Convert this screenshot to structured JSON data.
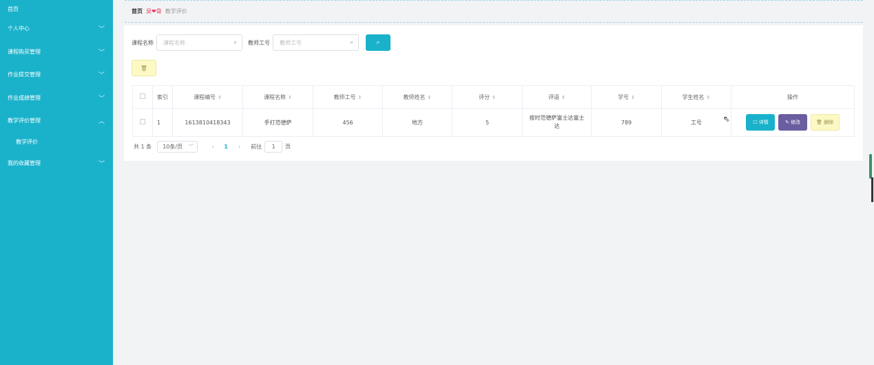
{
  "sidebar": {
    "items": [
      {
        "label": "首页",
        "chevron": ""
      },
      {
        "label": "个人中心",
        "chevron": "﹀"
      },
      {
        "label": "课程购买管理",
        "chevron": "﹀"
      },
      {
        "label": "作业提交管理",
        "chevron": "﹀"
      },
      {
        "label": "作业成绩管理",
        "chevron": "﹀"
      },
      {
        "label": "教学评价管理",
        "chevron": "︿"
      },
      {
        "label": "我的收藏管理",
        "chevron": "﹀"
      }
    ],
    "sub_item": "教学评价"
  },
  "breadcrumb": {
    "home": "首页",
    "separator": "吴❤骨",
    "current": "教学评价"
  },
  "search": {
    "course_name_label": "课程名称",
    "course_name_placeholder": "课程名称",
    "teacher_no_label": "教师工号",
    "teacher_no_placeholder": "教师工号",
    "search_icon": "search-icon",
    "search_glyph": "⌕"
  },
  "delete_button_glyph": "🗑",
  "table": {
    "headers": {
      "index": "索引",
      "course_no": "课程编号",
      "course_name": "课程名称",
      "teacher_no": "教师工号",
      "teacher_name": "教师姓名",
      "score": "评分",
      "comment": "评语",
      "student_no": "学号",
      "student_name": "学生姓名",
      "actions": "操作"
    },
    "sort_glyph": "⇕",
    "rows": [
      {
        "index": "1",
        "course_no": "1613810418343",
        "course_name": "手打范德萨",
        "teacher_no": "456",
        "teacher_name": "地方",
        "score": "5",
        "comment": "按时范德萨富士达富士达",
        "student_no": "789",
        "student_name": "工号"
      }
    ],
    "actions": {
      "detail": "☐ 详情",
      "edit": "✎ 修改",
      "delete": "🗑 删除"
    }
  },
  "pagination": {
    "total": "共 1 条",
    "page_size": "10条/页",
    "page_size_caret": "﹀",
    "prev": "‹",
    "current_page": "1",
    "next": "›",
    "goto_label": "前往",
    "goto_value": "1",
    "page_suffix": "页"
  },
  "colors": {
    "sidebar": "#1ab2cb",
    "primary": "#1ab2cb",
    "edit": "#6b5ea0",
    "delete": "#fdf9c4"
  }
}
